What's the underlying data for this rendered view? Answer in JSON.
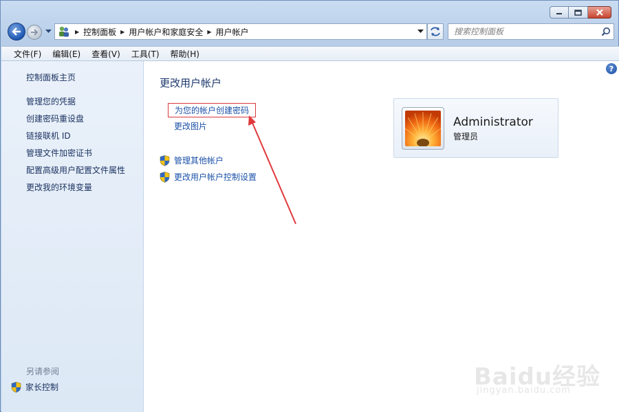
{
  "window": {
    "controls": {
      "minimize": "minimize",
      "maximize": "maximize",
      "close": "close"
    }
  },
  "navigation": {
    "breadcrumb": [
      "控制面板",
      "用户帐户和家庭安全",
      "用户帐户"
    ],
    "search_placeholder": "搜索控制面板"
  },
  "menu": [
    "文件(F)",
    "编辑(E)",
    "查看(V)",
    "工具(T)",
    "帮助(H)"
  ],
  "sidebar": {
    "items": [
      "控制面板主页",
      "管理您的凭据",
      "创建密码重设盘",
      "链接联机 ID",
      "管理文件加密证书",
      "配置高级用户配置文件属性",
      "更改我的环境变量"
    ],
    "see_also": "另请参阅",
    "parental_controls": "家长控制"
  },
  "main": {
    "title": "更改用户帐户",
    "tasks": [
      "为您的帐户创建密码",
      "更改图片"
    ],
    "shield_tasks": [
      "管理其他帐户",
      "更改用户帐户控制设置"
    ],
    "help": "?"
  },
  "user": {
    "name": "Administrator",
    "role": "管理员"
  },
  "annotation": {
    "color": "#e0383c"
  },
  "watermark": {
    "main": "Baidu经验",
    "sub": "jingyan.baidu.com"
  }
}
